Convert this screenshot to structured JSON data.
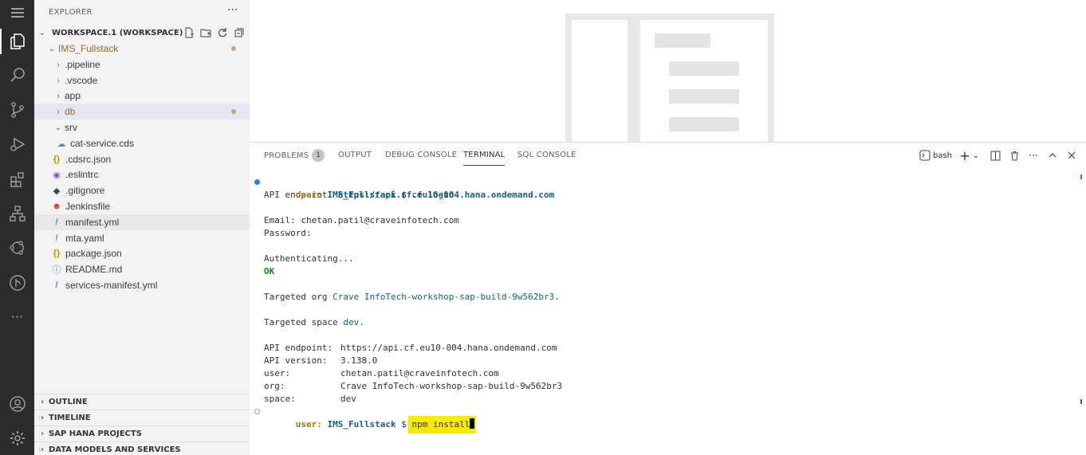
{
  "sidebar": {
    "header": "EXPLORER",
    "more": "···",
    "workspace_title": "WORKSPACE.1 (WORKSPACE)",
    "tree": [
      {
        "label": "IMS_Fullstack",
        "kind": "folder-open",
        "modified": true
      },
      {
        "label": ".pipeline",
        "kind": "folder"
      },
      {
        "label": ".vscode",
        "kind": "folder"
      },
      {
        "label": "app",
        "kind": "folder"
      },
      {
        "label": "db",
        "kind": "folder",
        "modified": true,
        "selected": true
      },
      {
        "label": "srv",
        "kind": "folder-open"
      },
      {
        "label": "cat-service.cds",
        "kind": "cds-file"
      },
      {
        "label": ".cdsrc.json",
        "kind": "json-file"
      },
      {
        "label": ".eslintrc",
        "kind": "eslint-file"
      },
      {
        "label": ".gitignore",
        "kind": "git-file"
      },
      {
        "label": "Jenkinsfile",
        "kind": "jenkins-file"
      },
      {
        "label": "manifest.yml",
        "kind": "yaml-file",
        "hover": true
      },
      {
        "label": "mta.yaml",
        "kind": "yaml-file"
      },
      {
        "label": "package.json",
        "kind": "json-file"
      },
      {
        "label": "README.md",
        "kind": "info-file"
      },
      {
        "label": "services-manifest.yml",
        "kind": "yaml-file"
      }
    ],
    "sections": [
      "OUTLINE",
      "TIMELINE",
      "SAP HANA PROJECTS",
      "DATA MODELS AND SERVICES"
    ]
  },
  "panel": {
    "tabs": [
      "PROBLEMS",
      "OUTPUT",
      "DEBUG CONSOLE",
      "TERMINAL",
      "SQL CONSOLE"
    ],
    "problems_count": "1",
    "terminal_shell": "bash"
  },
  "terminal": {
    "prompt_user": "user:",
    "prompt_dir": "IMS_Fullstack",
    "prompt_symbol": "$",
    "cmd1": "cf login",
    "api_label": "API endpoint:",
    "api_url": "https://api.cf.eu10-004.hana.ondemand.com",
    "email_label": "Email:",
    "email": "chetan.patil@craveinfotech.com",
    "password_label": "Password:",
    "authenticating": "Authenticating...",
    "ok": "OK",
    "targeted_org_label": "Targeted org",
    "org_name": "Crave InfoTech-workshop-sap-build-9w562br3",
    "targeted_space_label": "Targeted space",
    "space_name": "dev",
    "summary": [
      {
        "k": "API endpoint:",
        "v": "https://api.cf.eu10-004.hana.ondemand.com"
      },
      {
        "k": "API version:",
        "v": "3.138.0"
      },
      {
        "k": "user:",
        "v": "chetan.patil@craveinfotech.com"
      },
      {
        "k": "org:",
        "v": "Crave InfoTech-workshop-sap-build-9w562br3"
      },
      {
        "k": "space:",
        "v": "dev"
      }
    ],
    "cmd2": "npm install"
  },
  "colors": {
    "activity_bar": "#2c2c2c",
    "sidebar_bg": "#f3f3f3",
    "selected_row": "#e4e6f1",
    "highlight": "#f7ea00",
    "modified_dot": "#c2a875"
  }
}
